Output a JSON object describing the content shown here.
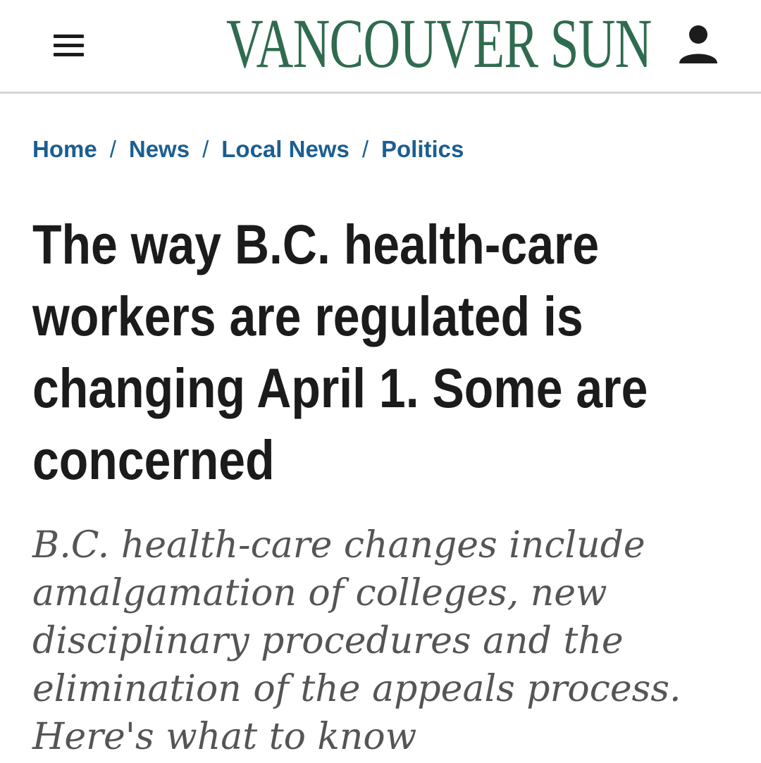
{
  "header": {
    "logo_text": "VANCOUVER SUN",
    "logo_color": "#2f6b4f",
    "menu_icon": "hamburger-menu-icon",
    "account_icon": "user-account-icon"
  },
  "breadcrumb": {
    "items": [
      "Home",
      "News",
      "Local News",
      "Politics"
    ],
    "separator": "/",
    "link_color": "#1a5e93"
  },
  "article": {
    "headline": "The way B.C. health-care workers are regulated is changing April 1. Some are concerned",
    "dek": "B.C. health-care changes include amalgamation of colleges, new disciplinary procedures and the elimination of the appeals process. Here's what to know"
  }
}
